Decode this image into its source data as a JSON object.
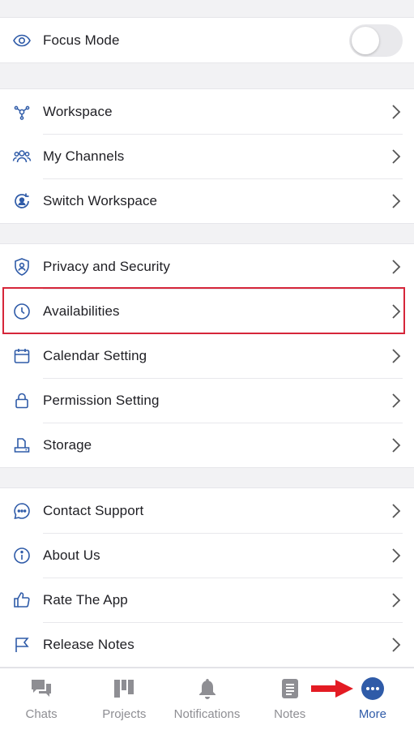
{
  "colors": {
    "accent": "#2f5ba8",
    "highlight_border": "#d6263a",
    "arrow": "#e31b23"
  },
  "focus": {
    "label": "Focus Mode",
    "icon": "eye-icon",
    "toggle_on": false
  },
  "workspace_section": [
    {
      "label": "Workspace",
      "icon": "workspace-nodes-icon"
    },
    {
      "label": "My Channels",
      "icon": "channels-people-icon"
    },
    {
      "label": "Switch Workspace",
      "icon": "switch-workspace-icon"
    }
  ],
  "settings_section": [
    {
      "label": "Privacy and Security",
      "icon": "shield-user-icon"
    },
    {
      "label": "Availabilities",
      "icon": "clock-icon"
    },
    {
      "label": "Calendar Setting",
      "icon": "calendar-icon"
    },
    {
      "label": "Permission Setting",
      "icon": "lock-icon"
    },
    {
      "label": "Storage",
      "icon": "storage-icon"
    }
  ],
  "support_section": [
    {
      "label": "Contact Support",
      "icon": "chat-bubble-icon"
    },
    {
      "label": "About Us",
      "icon": "info-icon"
    },
    {
      "label": "Rate The App",
      "icon": "thumbs-up-icon"
    },
    {
      "label": "Release Notes",
      "icon": "flag-icon"
    }
  ],
  "tabbar": [
    {
      "label": "Chats",
      "icon": "chats-icon",
      "active": false
    },
    {
      "label": "Projects",
      "icon": "projects-icon",
      "active": false
    },
    {
      "label": "Notifications",
      "icon": "bell-icon",
      "active": false
    },
    {
      "label": "Notes",
      "icon": "notes-icon",
      "active": false
    },
    {
      "label": "More",
      "icon": "more-dots-icon",
      "active": true
    }
  ]
}
